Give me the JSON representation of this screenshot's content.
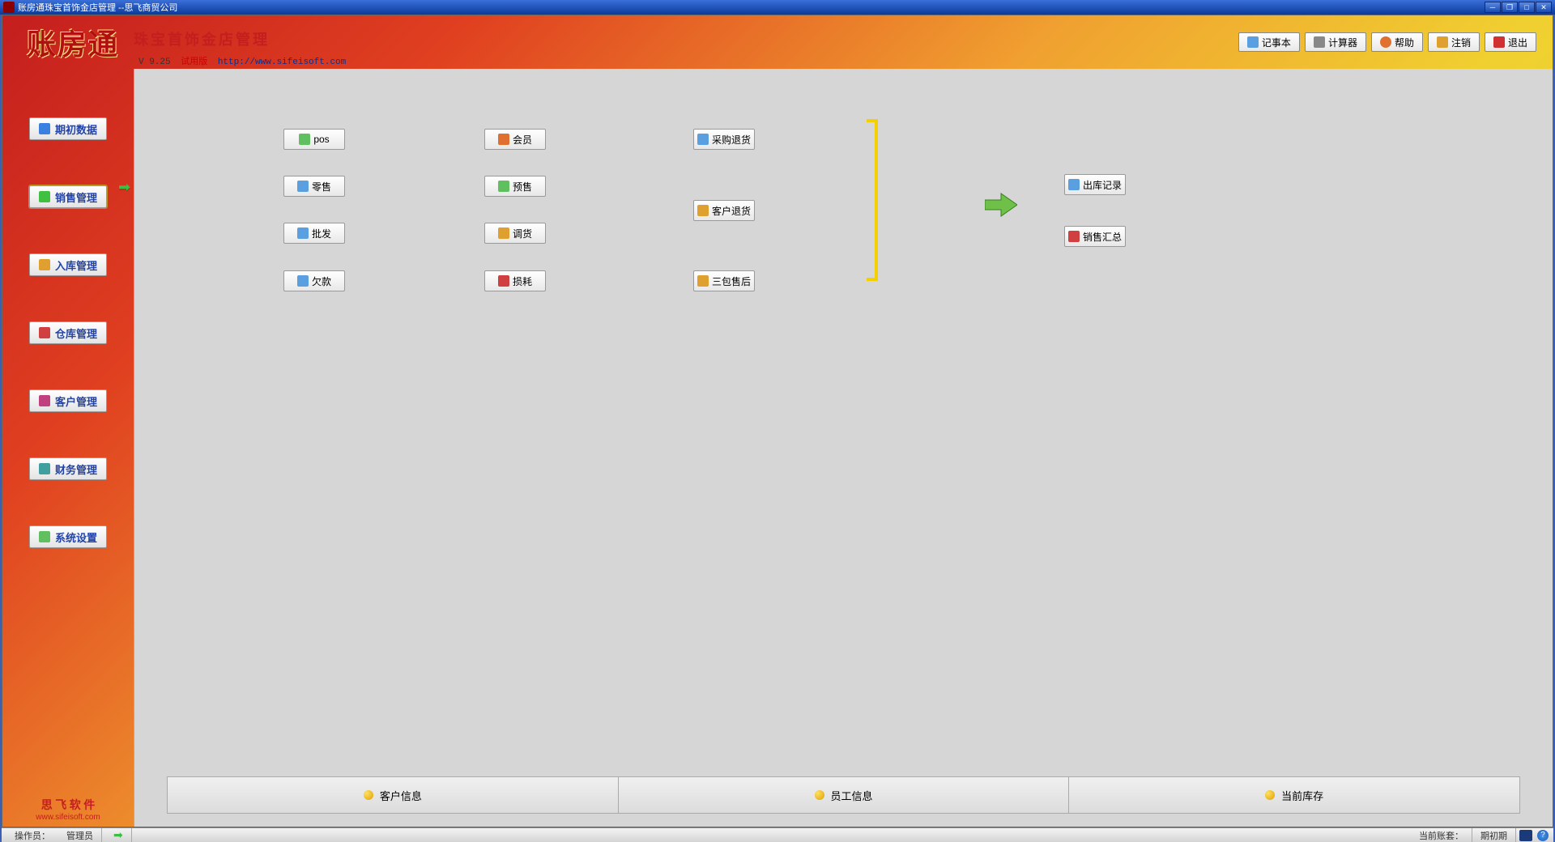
{
  "title": "账房通珠宝首饰金店管理 --思飞商贸公司",
  "header": {
    "logo": "账房通",
    "subtitle": "珠宝首饰金店管理",
    "version": "V 9.25",
    "trial": "试用版",
    "url": "http://www.sifeisoft.com"
  },
  "topButtons": {
    "notepad": "记事本",
    "calculator": "计算器",
    "help": "帮助",
    "logout": "注销",
    "exit": "退出"
  },
  "sidebar": {
    "items": [
      {
        "label": "期初数据",
        "icon": "#3a80e0"
      },
      {
        "label": "销售管理",
        "icon": "#40c040",
        "active": true
      },
      {
        "label": "入库管理",
        "icon": "#e0a030"
      },
      {
        "label": "仓库管理",
        "icon": "#d04040"
      },
      {
        "label": "客户管理",
        "icon": "#c04080"
      },
      {
        "label": "财务管理",
        "icon": "#40a0a0"
      },
      {
        "label": "系统设置",
        "icon": "#60c060"
      }
    ],
    "brand": "思 飞 软 件",
    "brandUrl": "www.sifeisoft.com"
  },
  "funcButtons": {
    "pos": "pos",
    "member": "会员",
    "purchaseReturn": "采购退货",
    "retail": "零售",
    "presale": "预售",
    "customerReturn": "客户退货",
    "wholesale": "批发",
    "transfer": "调货",
    "arrears": "欠款",
    "loss": "损耗",
    "afterSales": "三包售后",
    "outRecord": "出库记录",
    "salesSummary": "销售汇总"
  },
  "bottomBar": {
    "customerInfo": "客户信息",
    "staffInfo": "员工信息",
    "currentStock": "当前库存"
  },
  "statusbar": {
    "operatorLabel": "操作员：",
    "operatorValue": "管理员",
    "currentSet": "当前账套：",
    "period": "期初期"
  }
}
